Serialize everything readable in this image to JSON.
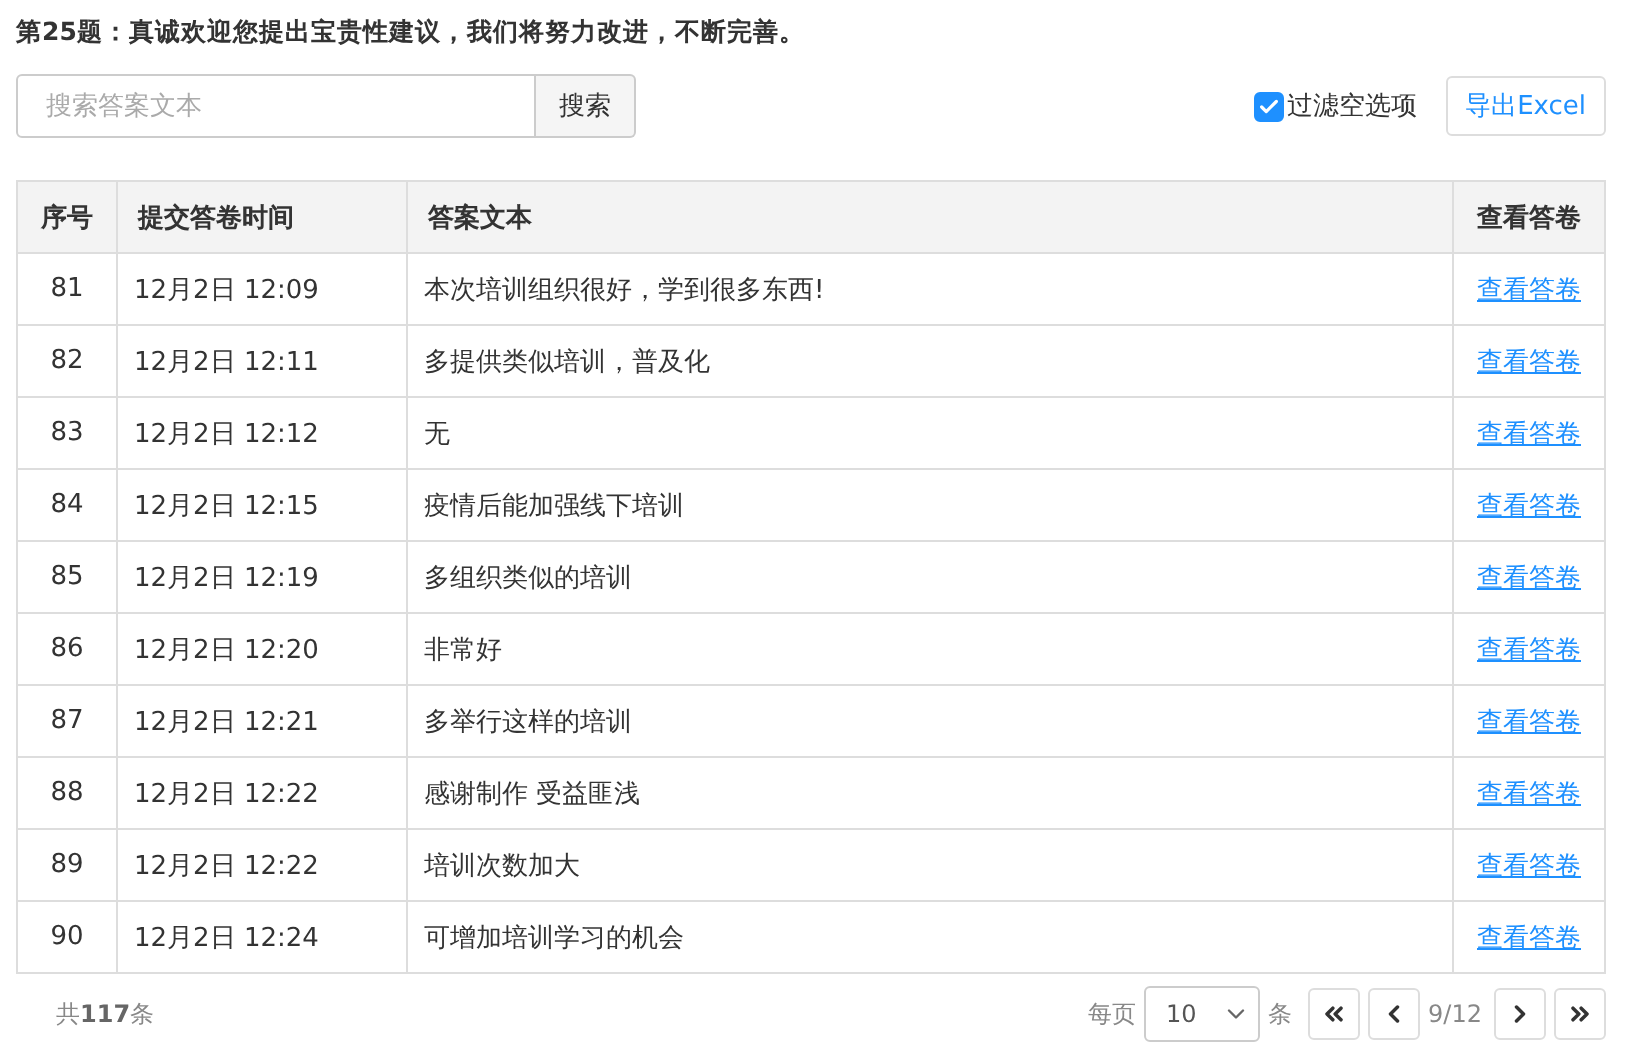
{
  "question_title": "第25题：真诚欢迎您提出宝贵性建议，我们将努力改进，不断完善。",
  "search": {
    "placeholder": "搜索答案文本",
    "button": "搜索"
  },
  "filter_empty": {
    "label": "过滤空选项",
    "checked": true
  },
  "export_button": "导出Excel",
  "table": {
    "columns": [
      "序号",
      "提交答卷时间",
      "答案文本",
      "查看答卷"
    ],
    "rows": [
      {
        "index": "81",
        "time": "12月2日 12:09",
        "answer": "本次培训组织很好，学到很多东西!",
        "link": "查看答卷"
      },
      {
        "index": "82",
        "time": "12月2日 12:11",
        "answer": "多提供类似培训，普及化",
        "link": "查看答卷"
      },
      {
        "index": "83",
        "time": "12月2日 12:12",
        "answer": "无",
        "link": "查看答卷"
      },
      {
        "index": "84",
        "time": "12月2日 12:15",
        "answer": "疫情后能加强线下培训",
        "link": "查看答卷"
      },
      {
        "index": "85",
        "time": "12月2日 12:19",
        "answer": "多组织类似的培训",
        "link": "查看答卷"
      },
      {
        "index": "86",
        "time": "12月2日 12:20",
        "answer": "非常好",
        "link": "查看答卷"
      },
      {
        "index": "87",
        "time": "12月2日 12:21",
        "answer": "多举行这样的培训",
        "link": "查看答卷"
      },
      {
        "index": "88",
        "time": "12月2日 12:22",
        "answer": "感谢制作 受益匪浅",
        "link": "查看答卷"
      },
      {
        "index": "89",
        "time": "12月2日 12:22",
        "answer": "培训次数加大",
        "link": "查看答卷"
      },
      {
        "index": "90",
        "time": "12月2日 12:24",
        "answer": "可增加培训学习的机会",
        "link": "查看答卷"
      }
    ]
  },
  "footer": {
    "total": "共**117**条",
    "per_page_label": "每页",
    "per_page_value": "10",
    "per_page_unit": "条",
    "page": "9/12"
  }
}
